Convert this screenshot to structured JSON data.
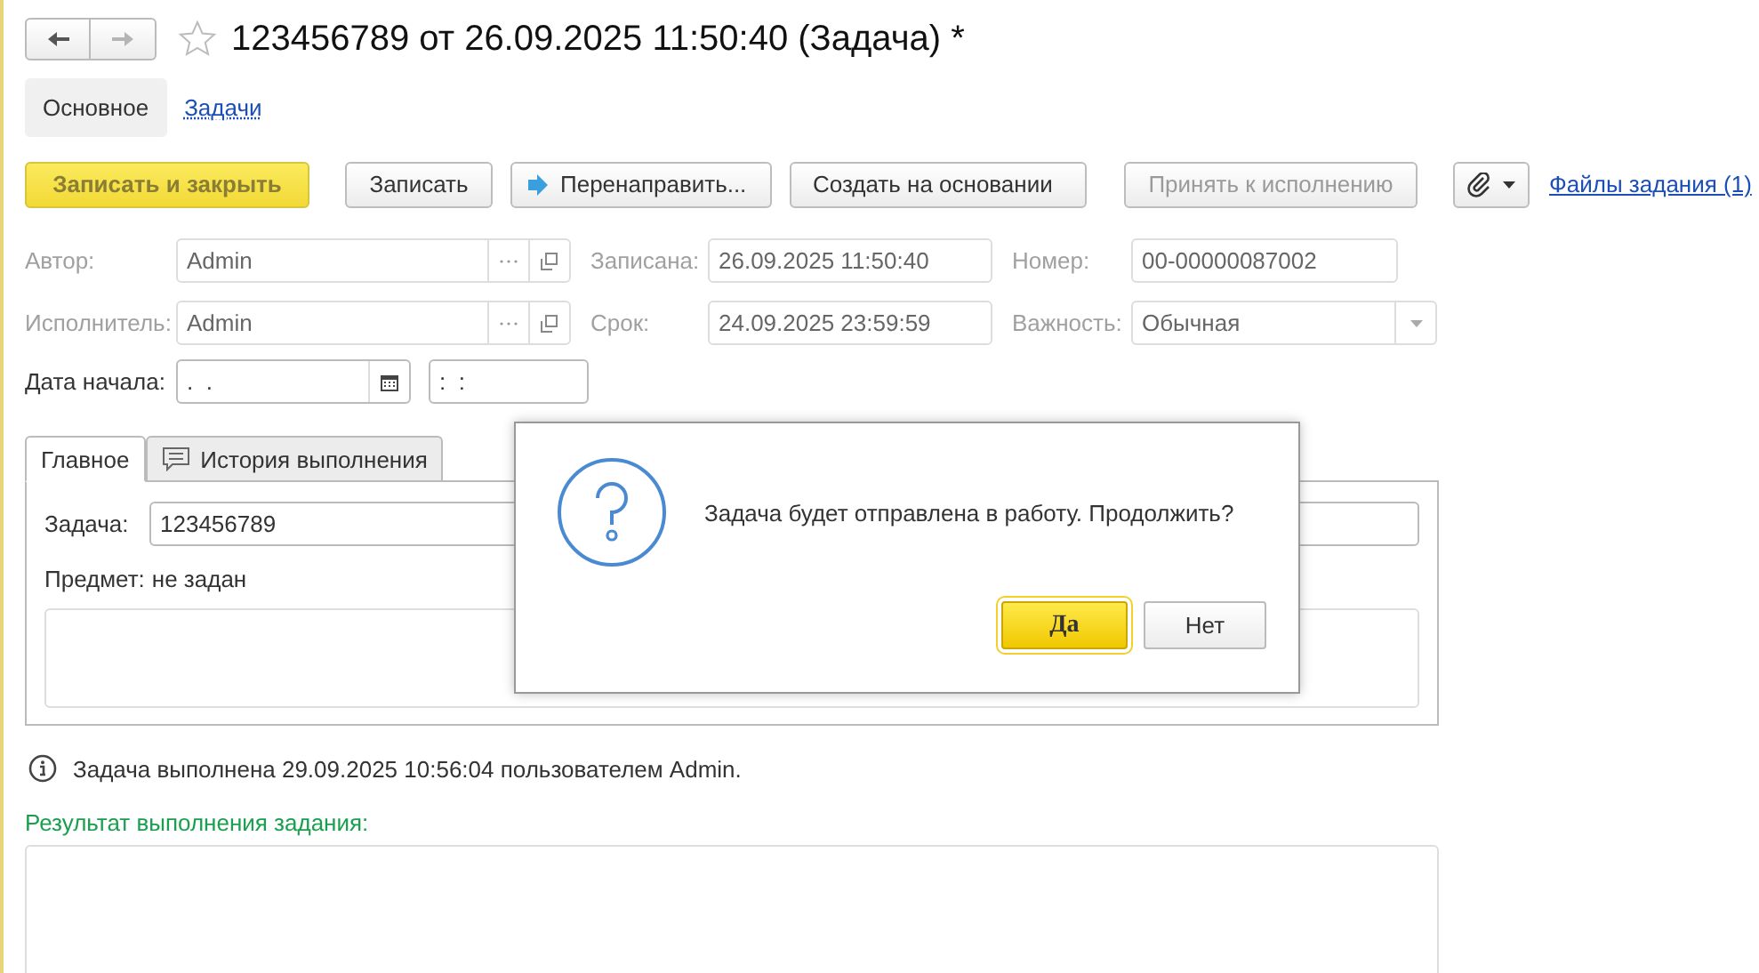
{
  "window": {
    "title": "123456789 от 26.09.2025 11:50:40 (Задача) *",
    "favorite": false
  },
  "history_buttons": [
    {
      "kind": "back",
      "disabled": false
    },
    {
      "kind": "forward",
      "disabled": true
    }
  ],
  "nav_tabs": [
    {
      "label": "Основное",
      "selected": true
    },
    {
      "label": "Задачи",
      "selected": false
    }
  ],
  "toolbar": {
    "buttons": [
      {
        "label": "Записать и закрыть",
        "kind": "default",
        "disabled": false
      },
      {
        "label": "Записать",
        "kind": "plain",
        "disabled": false
      },
      {
        "label": "Перенаправить...",
        "kind": "forward",
        "disabled": false
      },
      {
        "label": "Создать на основании",
        "kind": "dropdown",
        "disabled": false
      },
      {
        "label": "Принять к исполнению",
        "kind": "plain",
        "disabled": true
      },
      {
        "kind": "attach",
        "disabled": false
      }
    ],
    "link": "Файлы задания (1)"
  },
  "form_rows": [
    [
      {
        "label": "Автор:",
        "value": "Admin",
        "kind": "choice",
        "disabled": true
      },
      {
        "label": "Записана:",
        "value": "26.09.2025 11:50:40",
        "kind": "text",
        "disabled": true
      },
      {
        "label": "Номер:",
        "value": "00-00000087002",
        "kind": "text",
        "disabled": true
      }
    ],
    [
      {
        "label": "Исполнитель:",
        "value": "Admin",
        "kind": "choice",
        "disabled": true
      },
      {
        "label": "Срок:",
        "value": "24.09.2025 23:59:59",
        "kind": "text",
        "disabled": true
      },
      {
        "label": "Важность:",
        "value": "Обычная",
        "kind": "select",
        "disabled": true
      }
    ],
    [
      {
        "label": "Дата начала:",
        "value": ".  .",
        "kind": "date",
        "disabled": false
      },
      {
        "value": ":  :",
        "kind": "time",
        "disabled": false
      }
    ]
  ],
  "panel_tabs": [
    {
      "label": "Главное",
      "selected": true
    },
    {
      "label": "История выполнения",
      "selected": false
    }
  ],
  "panel": {
    "task_label": "Задача:",
    "task_value": "123456789",
    "subject_label": "Предмет:",
    "subject_value": "не задан"
  },
  "info": "Задача выполнена 29.09.2025 10:56:04 пользователем Admin.",
  "result_label": "Результат выполнения задания:",
  "dialog": {
    "message": "Задача будет отправлена в работу. Продолжить?",
    "buttons": [
      {
        "label": "Да",
        "kind": "default"
      },
      {
        "label": "Нет",
        "kind": "plain"
      }
    ]
  }
}
